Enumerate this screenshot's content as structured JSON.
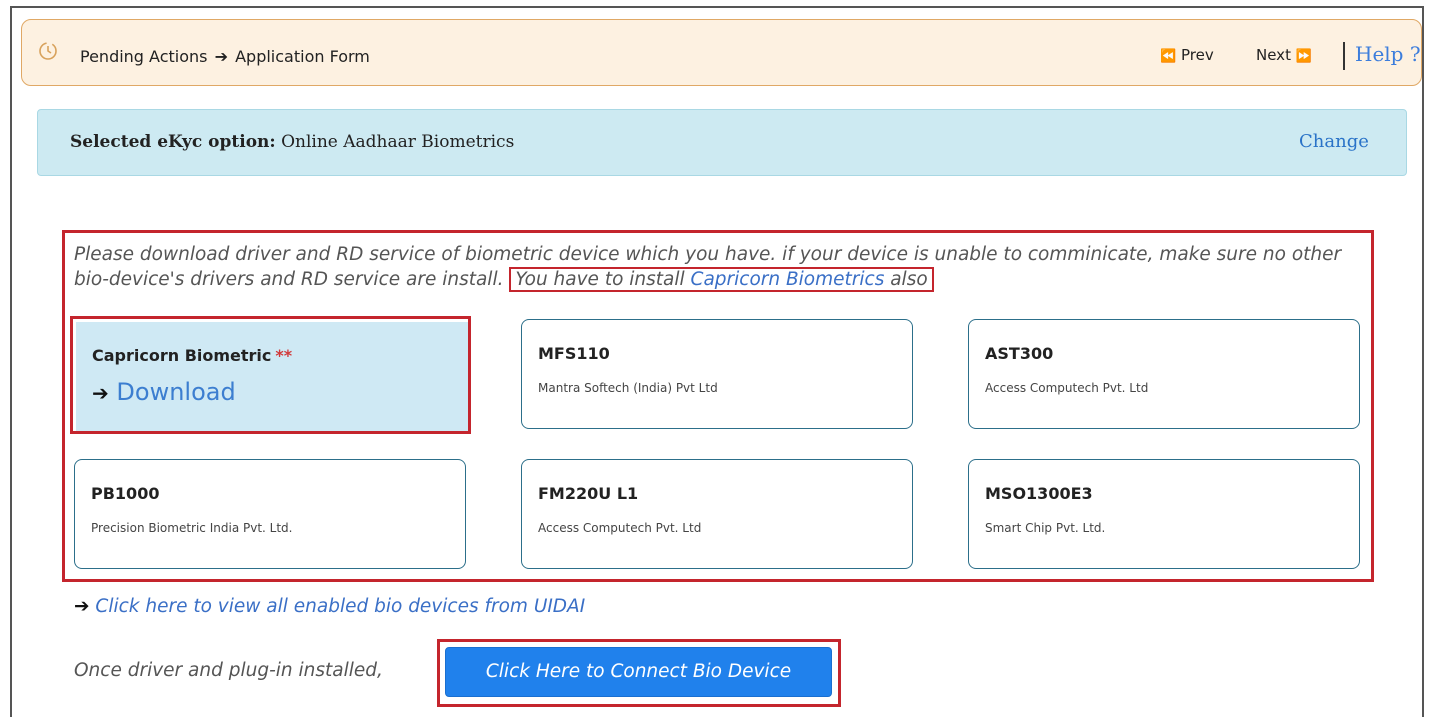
{
  "header": {
    "clock_icon": "clock-icon",
    "crumb_1": "Pending Actions",
    "crumb_arrow": "➔",
    "crumb_2": "Application Form",
    "prev_icon": "⏪",
    "prev_label": "Prev",
    "next_label": "Next",
    "next_icon": "⏩",
    "help_label": "Help ?"
  },
  "ekyc": {
    "label_bold": "Selected eKyc option:",
    "value": "Online Aadhaar Biometrics",
    "change_label": "Change"
  },
  "notice": {
    "text_1": "Please download driver and RD service of biometric device which you have. if your device is unable to comminicate, make sure no other bio-device's drivers and RD service are install.",
    "boxed_prefix": "You have to install ",
    "boxed_link": "Capricorn Biometrics",
    "boxed_suffix": " also"
  },
  "devices": [
    {
      "name": "Capricorn Biometric",
      "stars": "**",
      "download_arrow": "➔",
      "download_label": "Download"
    },
    {
      "name": "MFS110",
      "vendor": "Mantra Softech (India) Pvt Ltd"
    },
    {
      "name": "AST300",
      "vendor": "Access Computech Pvt. Ltd"
    },
    {
      "name": "PB1000",
      "vendor": "Precision Biometric India Pvt. Ltd."
    },
    {
      "name": "FM220U L1",
      "vendor": "Access Computech Pvt. Ltd"
    },
    {
      "name": "MSO1300E3",
      "vendor": "Smart Chip Pvt. Ltd."
    }
  ],
  "bio_link": {
    "arrow": "➔",
    "label": "Click here to view all enabled bio devices from UIDAI"
  },
  "connect": {
    "prefix": "Once driver and plug-in installed,",
    "button_label": "Click Here to Connect Bio Device"
  },
  "colors": {
    "accent_red": "#c4252d",
    "link_blue": "#3a6fc6",
    "button_blue": "#2081ec",
    "panel_blue": "#cdeaf2",
    "header_bg": "#fdf1e1"
  }
}
